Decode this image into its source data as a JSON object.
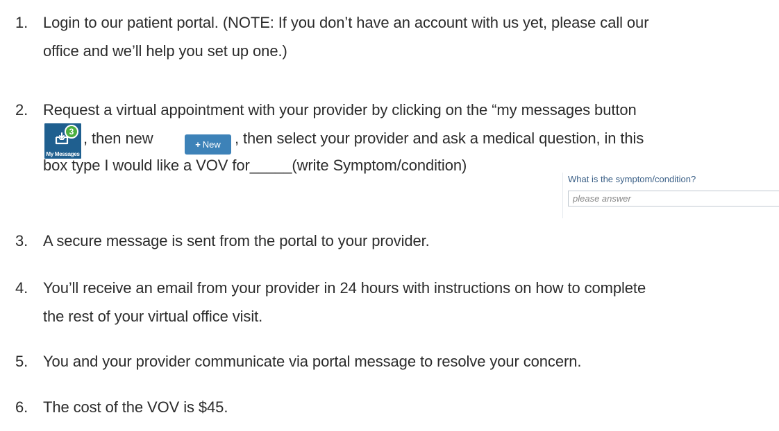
{
  "steps": [
    {
      "num": "1.",
      "lines": [
        "Login to our patient portal. (NOTE: If you don’t have an account with us yet, please call our",
        "office and we’ll help you set up one.)"
      ]
    },
    {
      "num": "2.",
      "line1": "Request a virtual appointment with your provider by clicking on the “my messages button",
      "line2_a": ", then new",
      "line2_b": ", then select your provider and ask a medical question, in this",
      "line3": "box type I would like a VOV for_____(write Symptom/condition)"
    },
    {
      "num": "3.",
      "lines": [
        "A secure message is sent from the portal to your provider."
      ]
    },
    {
      "num": "4.",
      "lines": [
        "You’ll receive an email from your provider in 24 hours with instructions on how to complete",
        "the rest of your virtual office visit."
      ]
    },
    {
      "num": "5.",
      "lines": [
        "You and your provider communicate via portal message to resolve your concern."
      ]
    },
    {
      "num": "6.",
      "lines": [
        "The cost of the VOV is $45."
      ]
    }
  ],
  "my_messages": {
    "badge": "3",
    "caption": "My Messages",
    "icon": "inbox-tray-icon",
    "color": "#1f5f8f",
    "badge_color": "#4caf3f"
  },
  "new_button": {
    "plus": "+",
    "label": "New",
    "color": "#3d82b8"
  },
  "symptom_form": {
    "label": "What is the symptom/condition?",
    "placeholder": "please answer"
  }
}
